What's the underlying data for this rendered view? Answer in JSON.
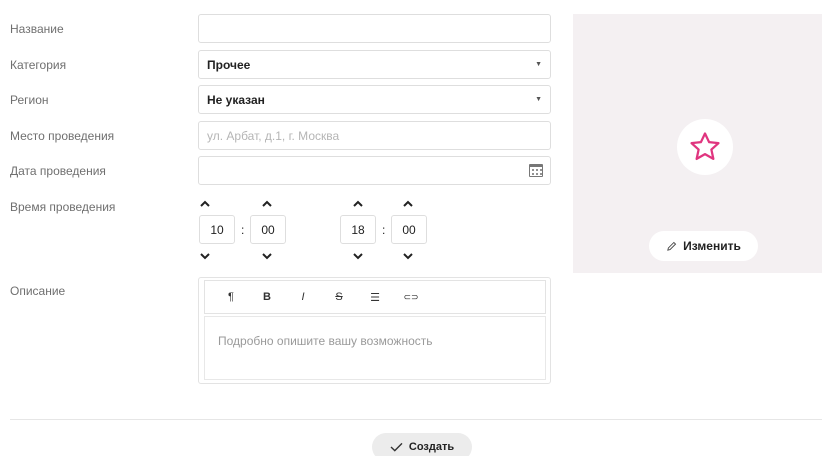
{
  "form": {
    "labels": {
      "name": "Название",
      "category": "Категория",
      "region": "Регион",
      "venue": "Место проведения",
      "date": "Дата проведения",
      "time": "Время проведения",
      "description": "Описание"
    },
    "name_value": "",
    "category_value": "Прочее",
    "region_value": "Не указан",
    "venue_placeholder": "ул. Арбат, д.1, г. Москва",
    "date_value": "",
    "time": {
      "start_hours": "10",
      "start_minutes": "00",
      "end_hours": "18",
      "end_minutes": "00",
      "separator": ":"
    },
    "editor": {
      "toolbar": {
        "paragraph": "¶",
        "bold": "B",
        "italic": "I",
        "strike": "S",
        "list": "☰",
        "link": "⊂⊃"
      },
      "placeholder": "Подробно опишите вашу возможность"
    },
    "image_panel": {
      "icon": "star-icon",
      "change_label": "Изменить",
      "change_icon": "pencil-icon",
      "accent_color": "#e0357f"
    },
    "submit": {
      "label": "Создать",
      "icon": "check-icon"
    }
  }
}
